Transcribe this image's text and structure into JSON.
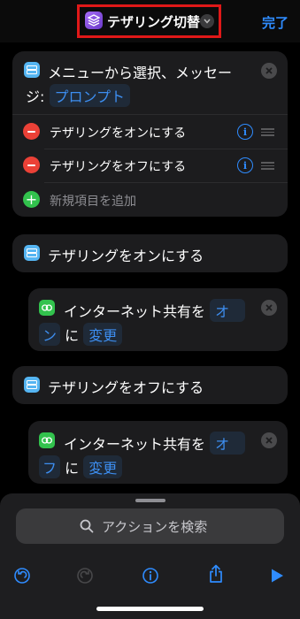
{
  "header": {
    "title": "テザリング切替",
    "done_label": "完了"
  },
  "menu_action": {
    "title_line1": "メニューから選択、メッセー",
    "title_line2_prefix": "ジ:",
    "prompt_pill": "プロンプト",
    "items": [
      {
        "label": "テザリングをオンにする"
      },
      {
        "label": "テザリングをオフにする"
      }
    ],
    "add_item_label": "新規項目を追加"
  },
  "branch_on": {
    "header_label": "テザリングをオンにする",
    "action_prefix": "インターネット共有を",
    "value_part1": "オ",
    "value_part2": "ン",
    "connector": "に",
    "change_label": "変更"
  },
  "branch_off": {
    "header_label": "テザリングをオフにする",
    "action_prefix": "インターネット共有を",
    "value_part1": "オ",
    "value_part2": "フ",
    "connector": "に",
    "change_label": "変更"
  },
  "bottom_sheet": {
    "search_placeholder": "アクションを検索"
  },
  "toolbar": {
    "icons": [
      "undo-icon",
      "redo-icon",
      "info-icon",
      "share-icon",
      "play-icon"
    ]
  },
  "colors": {
    "accent": "#2f8cff",
    "background": "#000000",
    "card": "#1c1c1e",
    "menu_icon": "#55b5f2",
    "network_icon": "#32c24d",
    "delete": "#eb4137",
    "highlight_box": "#e01818"
  }
}
